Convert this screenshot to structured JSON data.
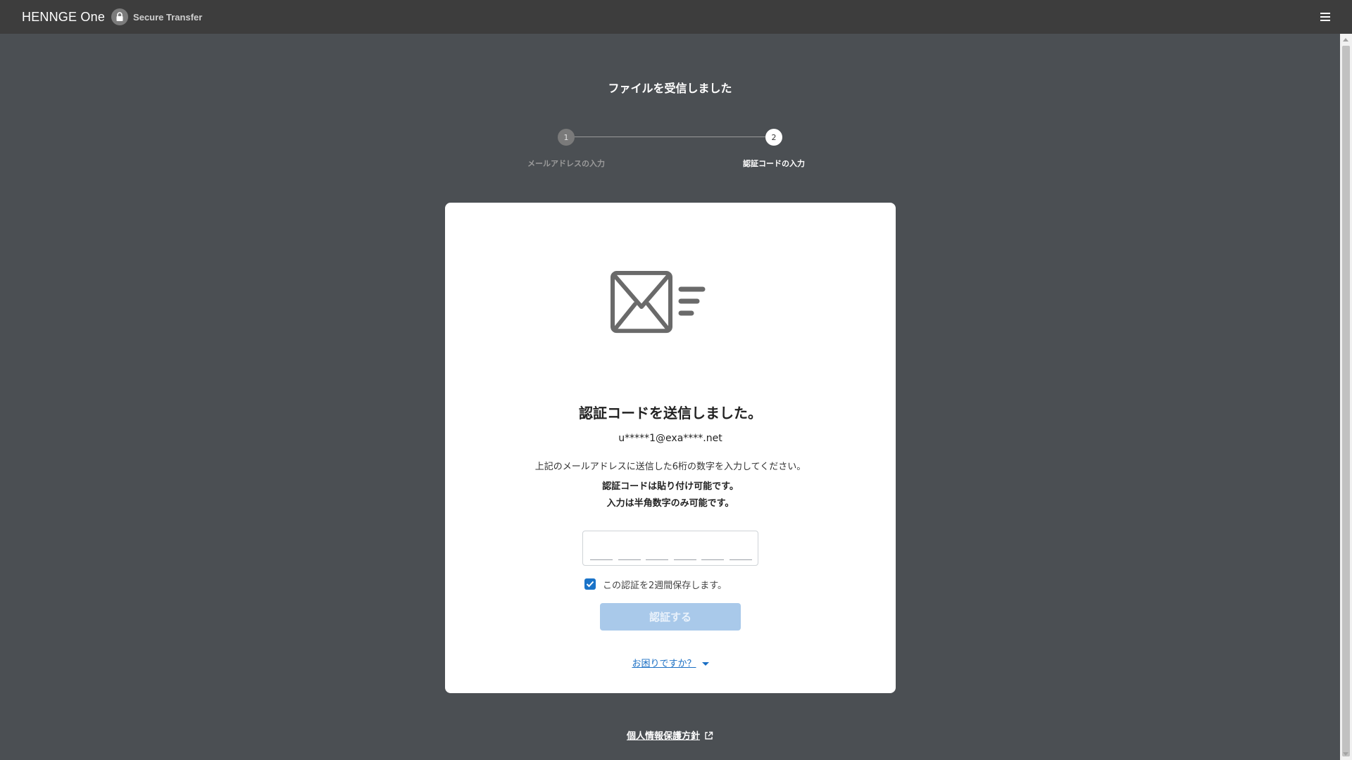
{
  "header": {
    "brand_name": "HENNGE One",
    "product_name": "Secure Transfer",
    "menu_icon": "hamburger-menu-icon",
    "badge_icon": "lock-icon"
  },
  "page": {
    "title": "ファイルを受信しました"
  },
  "stepper": {
    "steps": [
      {
        "number": "1",
        "label": "メールアドレスの入力",
        "active": false
      },
      {
        "number": "2",
        "label": "認証コードの入力",
        "active": true
      }
    ]
  },
  "card": {
    "icon": "mail-send-icon",
    "heading": "認証コードを送信しました。",
    "email": "u*****1@exa****.net",
    "instruction": "上記のメールアドレスに送信した6桁の数字を入力してください。",
    "note1": "認証コードは貼り付け可能です。",
    "note2": "入力は半角数字のみ可能です。",
    "code_input": {
      "value": "",
      "digits": 6
    },
    "remember": {
      "label": "この認証を2週間保存します。",
      "checked": true
    },
    "verify_button": "認証する",
    "help_link": "お困りですか？"
  },
  "footer": {
    "privacy_link": "個人情報保護方針",
    "external_icon": "external-link-icon"
  },
  "colors": {
    "background": "#4b4f53",
    "topbar": "#3d3d3d",
    "accent": "#1a73c8",
    "button_disabled": "#a9c9ea"
  }
}
